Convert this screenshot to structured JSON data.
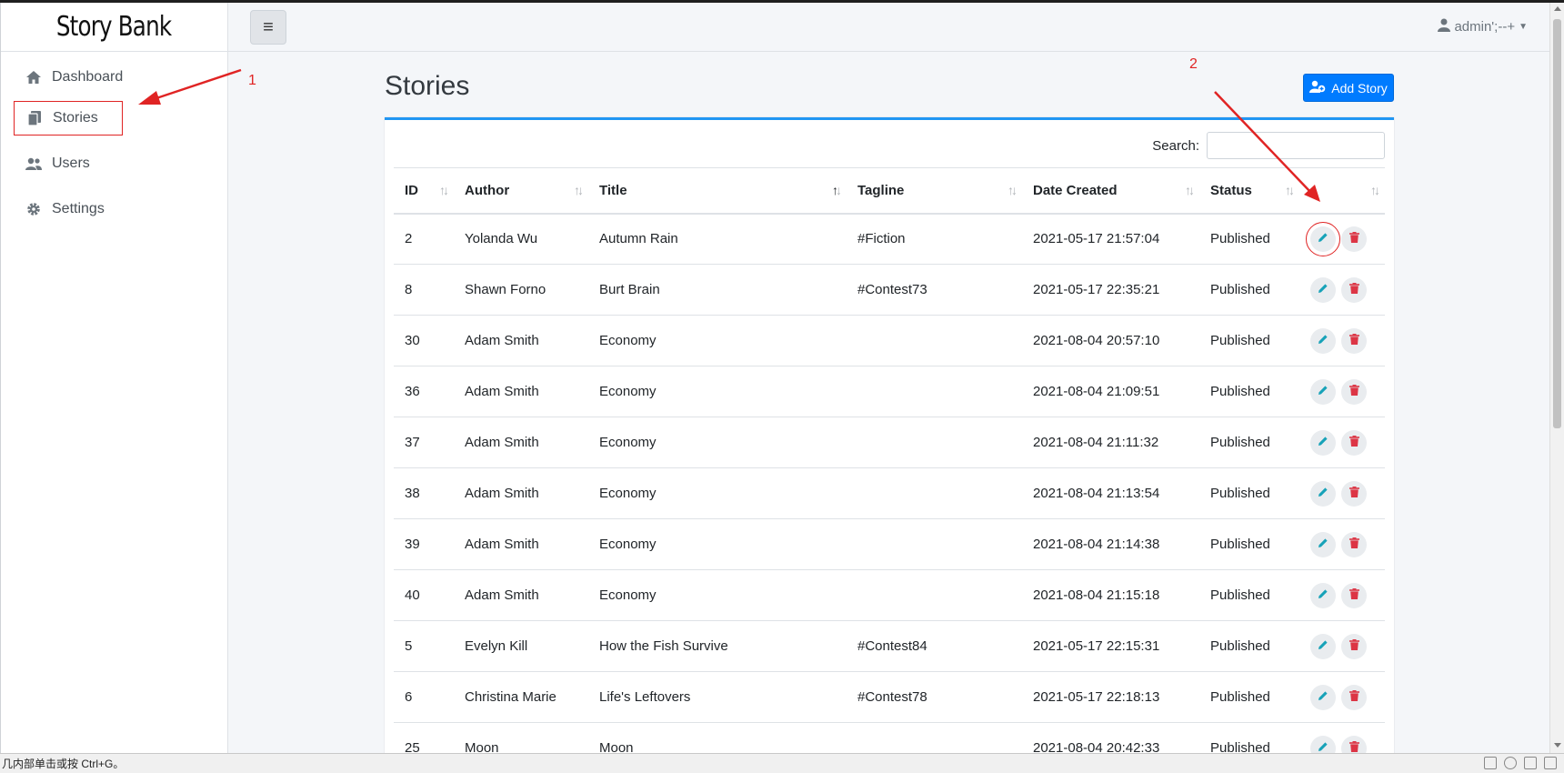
{
  "app": {
    "brand": "Story Bank"
  },
  "sidebar": {
    "items": [
      {
        "label": "Dashboard",
        "icon": "home-icon"
      },
      {
        "label": "Stories",
        "icon": "copy-icon",
        "active": true
      },
      {
        "label": "Users",
        "icon": "users-icon"
      },
      {
        "label": "Settings",
        "icon": "gear-icon"
      }
    ]
  },
  "topbar": {
    "menu_icon": "≡",
    "user": "admin';--+"
  },
  "page": {
    "title": "Stories",
    "add_button": "Add Story"
  },
  "search": {
    "label": "Search:",
    "value": ""
  },
  "table": {
    "columns": [
      "ID",
      "Author",
      "Title",
      "Tagline",
      "Date Created",
      "Status",
      ""
    ],
    "sorted_column": "Title",
    "rows": [
      {
        "id": "2",
        "author": "Yolanda Wu",
        "title": "Autumn Rain",
        "tagline": "#Fiction",
        "date": "2021-05-17 21:57:04",
        "status": "Published"
      },
      {
        "id": "8",
        "author": "Shawn Forno",
        "title": "Burt Brain",
        "tagline": "#Contest73",
        "date": "2021-05-17 22:35:21",
        "status": "Published"
      },
      {
        "id": "30",
        "author": "Adam Smith",
        "title": "Economy",
        "tagline": "",
        "date": "2021-08-04 20:57:10",
        "status": "Published"
      },
      {
        "id": "36",
        "author": "Adam Smith",
        "title": "Economy",
        "tagline": "",
        "date": "2021-08-04 21:09:51",
        "status": "Published"
      },
      {
        "id": "37",
        "author": "Adam Smith",
        "title": "Economy",
        "tagline": "",
        "date": "2021-08-04 21:11:32",
        "status": "Published"
      },
      {
        "id": "38",
        "author": "Adam Smith",
        "title": "Economy",
        "tagline": "",
        "date": "2021-08-04 21:13:54",
        "status": "Published"
      },
      {
        "id": "39",
        "author": "Adam Smith",
        "title": "Economy",
        "tagline": "",
        "date": "2021-08-04 21:14:38",
        "status": "Published"
      },
      {
        "id": "40",
        "author": "Adam Smith",
        "title": "Economy",
        "tagline": "",
        "date": "2021-08-04 21:15:18",
        "status": "Published"
      },
      {
        "id": "5",
        "author": "Evelyn Kill",
        "title": "How the Fish Survive",
        "tagline": "#Contest84",
        "date": "2021-05-17 22:15:31",
        "status": "Published"
      },
      {
        "id": "6",
        "author": "Christina Marie",
        "title": "Life's Leftovers",
        "tagline": "#Contest78",
        "date": "2021-05-17 22:18:13",
        "status": "Published"
      },
      {
        "id": "25",
        "author": "Moon",
        "title": "Moon",
        "tagline": "",
        "date": "2021-08-04 20:42:33",
        "status": "Published"
      }
    ]
  },
  "annotations": {
    "one": "1",
    "two": "2"
  },
  "statusbar": {
    "text": "几内部单击或按 Ctrl+G。"
  },
  "colors": {
    "primary": "#007bff",
    "card_accent": "#2196f3",
    "danger": "#dc3545",
    "info": "#17a2b8",
    "annotation": "#e02424"
  }
}
